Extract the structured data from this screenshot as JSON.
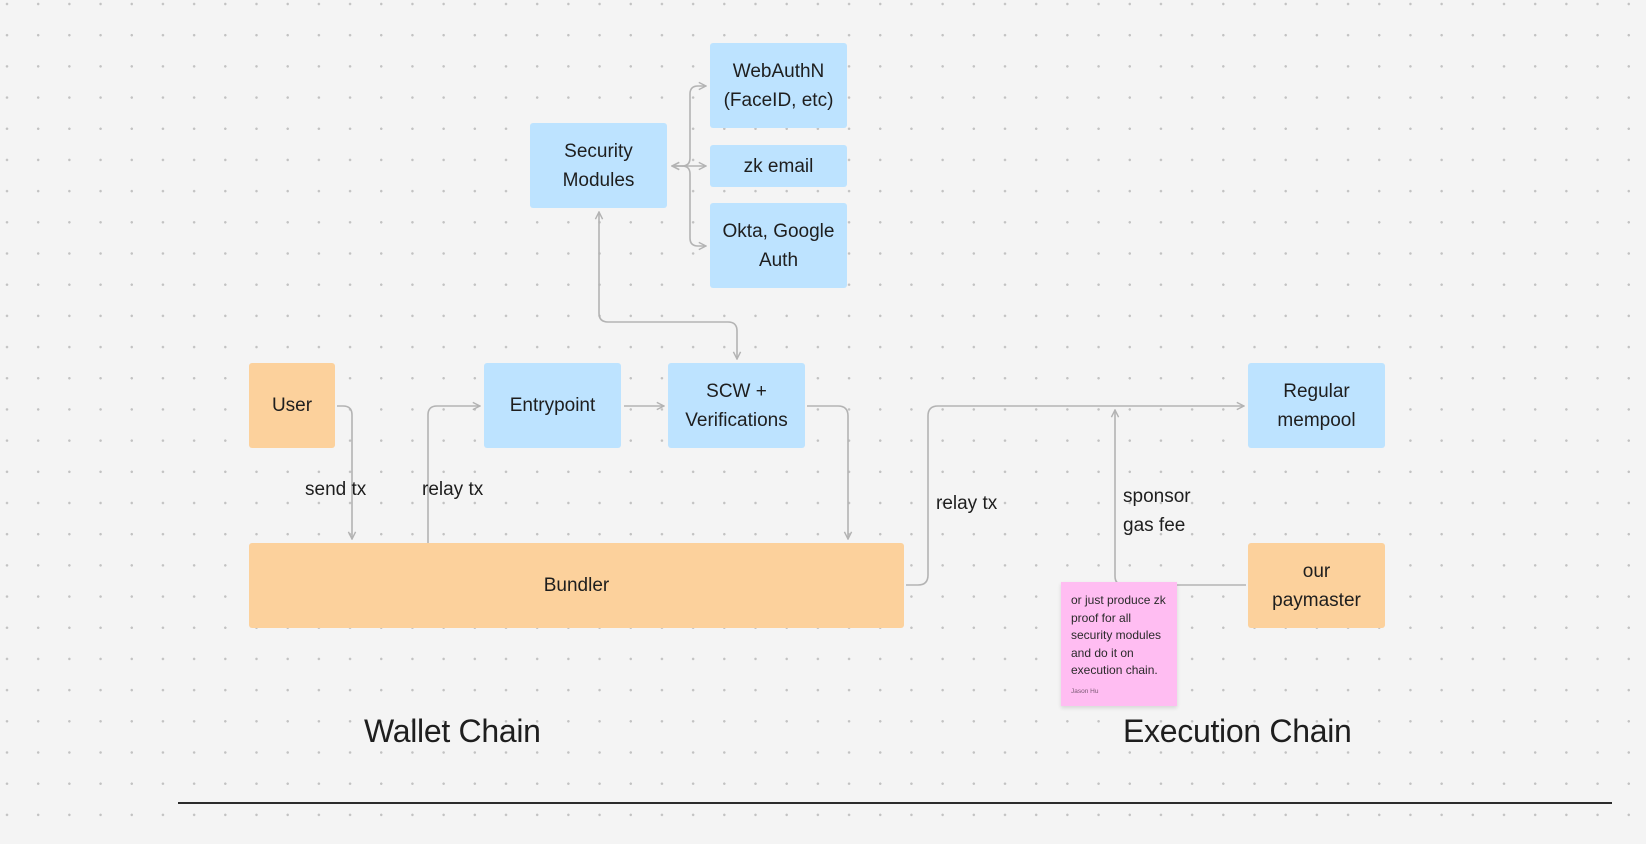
{
  "canvas": {
    "background_color": "#f4f4f4",
    "dot_color": "#c2c2c2"
  },
  "colors": {
    "blue_node": "#bde3ff",
    "orange_node": "#fcd19c",
    "sticky_note": "#ffbdf2",
    "connector": "#b3b3b3",
    "text": "#1e1e1e"
  },
  "nodes": {
    "webauthn": "WebAuthN\n(FaceID, etc)",
    "zk_email": "zk email",
    "okta": "Okta, Google\nAuth",
    "security_modules": "Security\nModules",
    "user": "User",
    "entrypoint": "Entrypoint",
    "scw": "SCW +\nVerifications",
    "regular_mempool": "Regular\nmempool",
    "bundler": "Bundler",
    "paymaster": "our\npaymaster"
  },
  "edge_labels": {
    "send_tx": "send tx",
    "relay_tx_1": "relay tx",
    "relay_tx_2": "relay tx",
    "sponsor_gas_fee": "sponsor\ngas fee"
  },
  "sticky_note": {
    "text": "or just produce zk\nproof for all\nsecurity modules\nand do it on\nexecution chain.",
    "author": "Jason Hu"
  },
  "sections": {
    "wallet_chain": "Wallet Chain",
    "execution_chain": "Execution Chain"
  },
  "edges": [
    {
      "from": "security_modules",
      "to": "webauthn",
      "bidirectional": true
    },
    {
      "from": "security_modules",
      "to": "zk_email",
      "bidirectional": true
    },
    {
      "from": "security_modules",
      "to": "okta",
      "bidirectional": true
    },
    {
      "from": "user",
      "to": "bundler",
      "label": "send tx"
    },
    {
      "from": "bundler",
      "to": "entrypoint",
      "label": "relay tx"
    },
    {
      "from": "entrypoint",
      "to": "scw"
    },
    {
      "from": "scw",
      "to": "bundler"
    },
    {
      "from": "scw",
      "to": "security_modules",
      "bidirectional": true
    },
    {
      "from": "bundler",
      "to": "regular_mempool",
      "label": "relay tx"
    },
    {
      "from": "paymaster",
      "to": "regular_mempool",
      "label": "sponsor gas fee"
    }
  ]
}
